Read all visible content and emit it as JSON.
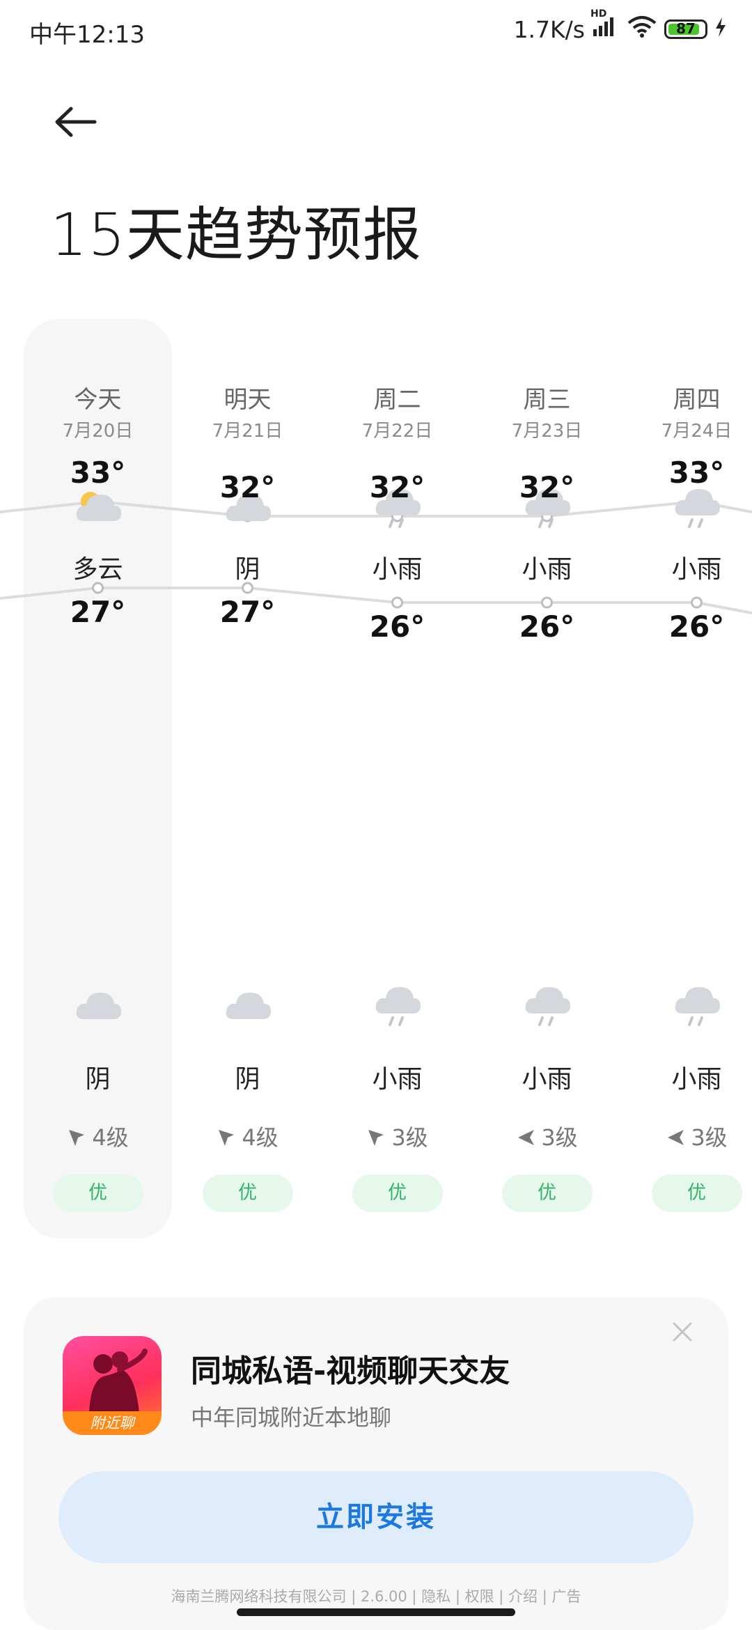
{
  "status_bar": {
    "time": "中午12:13",
    "network_speed": "1.7K/s",
    "hd_badge": "HD",
    "battery_level": "87",
    "battery_percent": 87,
    "icons": [
      "signal-icon",
      "wifi-icon",
      "battery-icon",
      "charging-icon"
    ]
  },
  "header": {
    "back_icon": "arrow-left-icon",
    "title": "15天趋势预报"
  },
  "forecast": {
    "days": [
      {
        "name": "今天",
        "date": "7月20日",
        "day_icon": "partly-cloudy-icon",
        "day_cond": "多云",
        "high": "33°",
        "low": "27°",
        "night_icon": "cloudy-icon",
        "night_cond": "阴",
        "wind": "4级",
        "wind_dir": "northeast",
        "aqi": "优"
      },
      {
        "name": "明天",
        "date": "7月21日",
        "day_icon": "cloudy-icon",
        "day_cond": "阴",
        "high": "32°",
        "low": "27°",
        "night_icon": "cloudy-icon",
        "night_cond": "阴",
        "wind": "4级",
        "wind_dir": "northeast",
        "aqi": "优"
      },
      {
        "name": "周二",
        "date": "7月22日",
        "day_icon": "light-rain-icon",
        "day_cond": "小雨",
        "high": "32°",
        "low": "26°",
        "night_icon": "light-rain-icon",
        "night_cond": "小雨",
        "wind": "3级",
        "wind_dir": "northeast",
        "aqi": "优"
      },
      {
        "name": "周三",
        "date": "7月23日",
        "day_icon": "light-rain-icon",
        "day_cond": "小雨",
        "high": "32°",
        "low": "26°",
        "night_icon": "light-rain-icon",
        "night_cond": "小雨",
        "wind": "3级",
        "wind_dir": "east",
        "aqi": "优"
      },
      {
        "name": "周四",
        "date": "7月24日",
        "day_icon": "light-rain-icon",
        "day_cond": "小雨",
        "high": "33°",
        "low": "26°",
        "night_icon": "light-rain-icon",
        "night_cond": "小雨",
        "wind": "3级",
        "wind_dir": "east",
        "aqi": "优"
      }
    ],
    "colors": {
      "today_bg": "#f6f6f6",
      "line": "#dcdcdc",
      "aqi_bg": "#e6f8ec",
      "aqi_text": "#34b46a"
    }
  },
  "ad": {
    "close_icon": "close-icon",
    "app_name": "同城私语-视频聊天交友",
    "subtitle": "中年同城附近本地聊",
    "logo_badge": "附近聊",
    "install_label": "立即安装",
    "footer": "海南兰腾网络科技有限公司 | 2.6.00 | 隐私 | 权限 | 介绍 | 广告",
    "colors": {
      "install_bg": "#dfecfb",
      "install_text": "#1a78e0"
    }
  }
}
